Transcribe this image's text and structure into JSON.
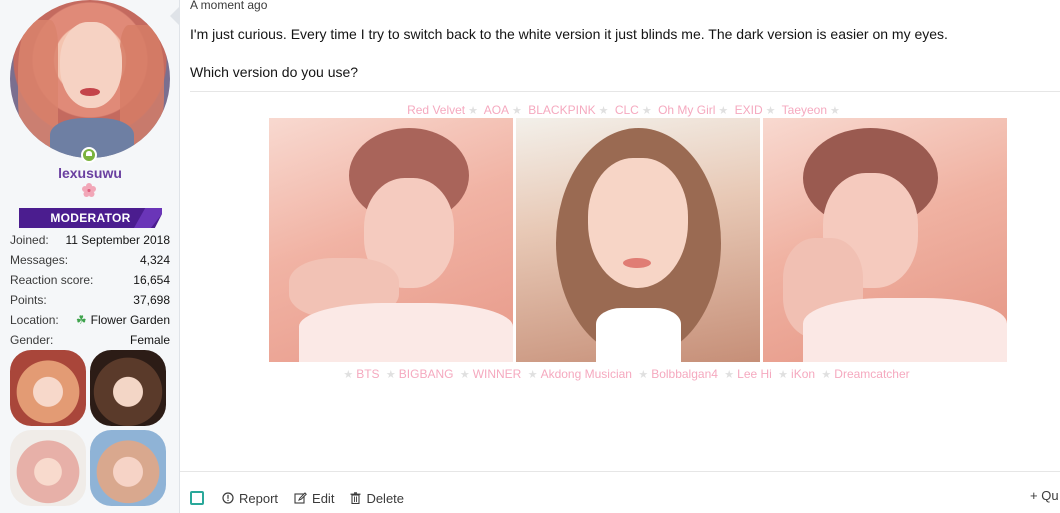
{
  "user": {
    "username": "lexusuwu",
    "role": "MODERATOR",
    "stats": [
      {
        "label": "Joined:",
        "value": "11 September 2018"
      },
      {
        "label": "Messages:",
        "value": "4,324"
      },
      {
        "label": "Reaction score:",
        "value": "16,654"
      },
      {
        "label": "Points:",
        "value": "37,698"
      },
      {
        "label": "Location:",
        "value": "Flower Garden"
      },
      {
        "label": "Gender:",
        "value": "Female"
      }
    ]
  },
  "post": {
    "time": "A moment ago",
    "paragraphs": [
      "I'm just curious. Every time I try to switch back to the white version it just blinds me. The dark version is easier on my eyes.",
      "Which version do you use?"
    ]
  },
  "signature": {
    "groups_top": [
      "Red Velvet",
      "AOA",
      "BLACKPINK",
      "CLC",
      "Oh My Girl",
      "EXID",
      "Taeyeon"
    ],
    "groups_bottom": [
      "BTS",
      "BIGBANG",
      "WINNER",
      "Akdong Musician",
      "Bolbbalgan4",
      "Lee Hi",
      "iKon",
      "Dreamcatcher"
    ]
  },
  "actions": {
    "report": "Report",
    "edit": "Edit",
    "delete": "Delete",
    "quote": "+ Qu"
  },
  "colors": {
    "username": "#6a3fa0",
    "role_badge": "#4b1d8f",
    "group_text": "#f5a9bf",
    "online": "#7bb33e",
    "checkbox": "#2aa89a"
  }
}
